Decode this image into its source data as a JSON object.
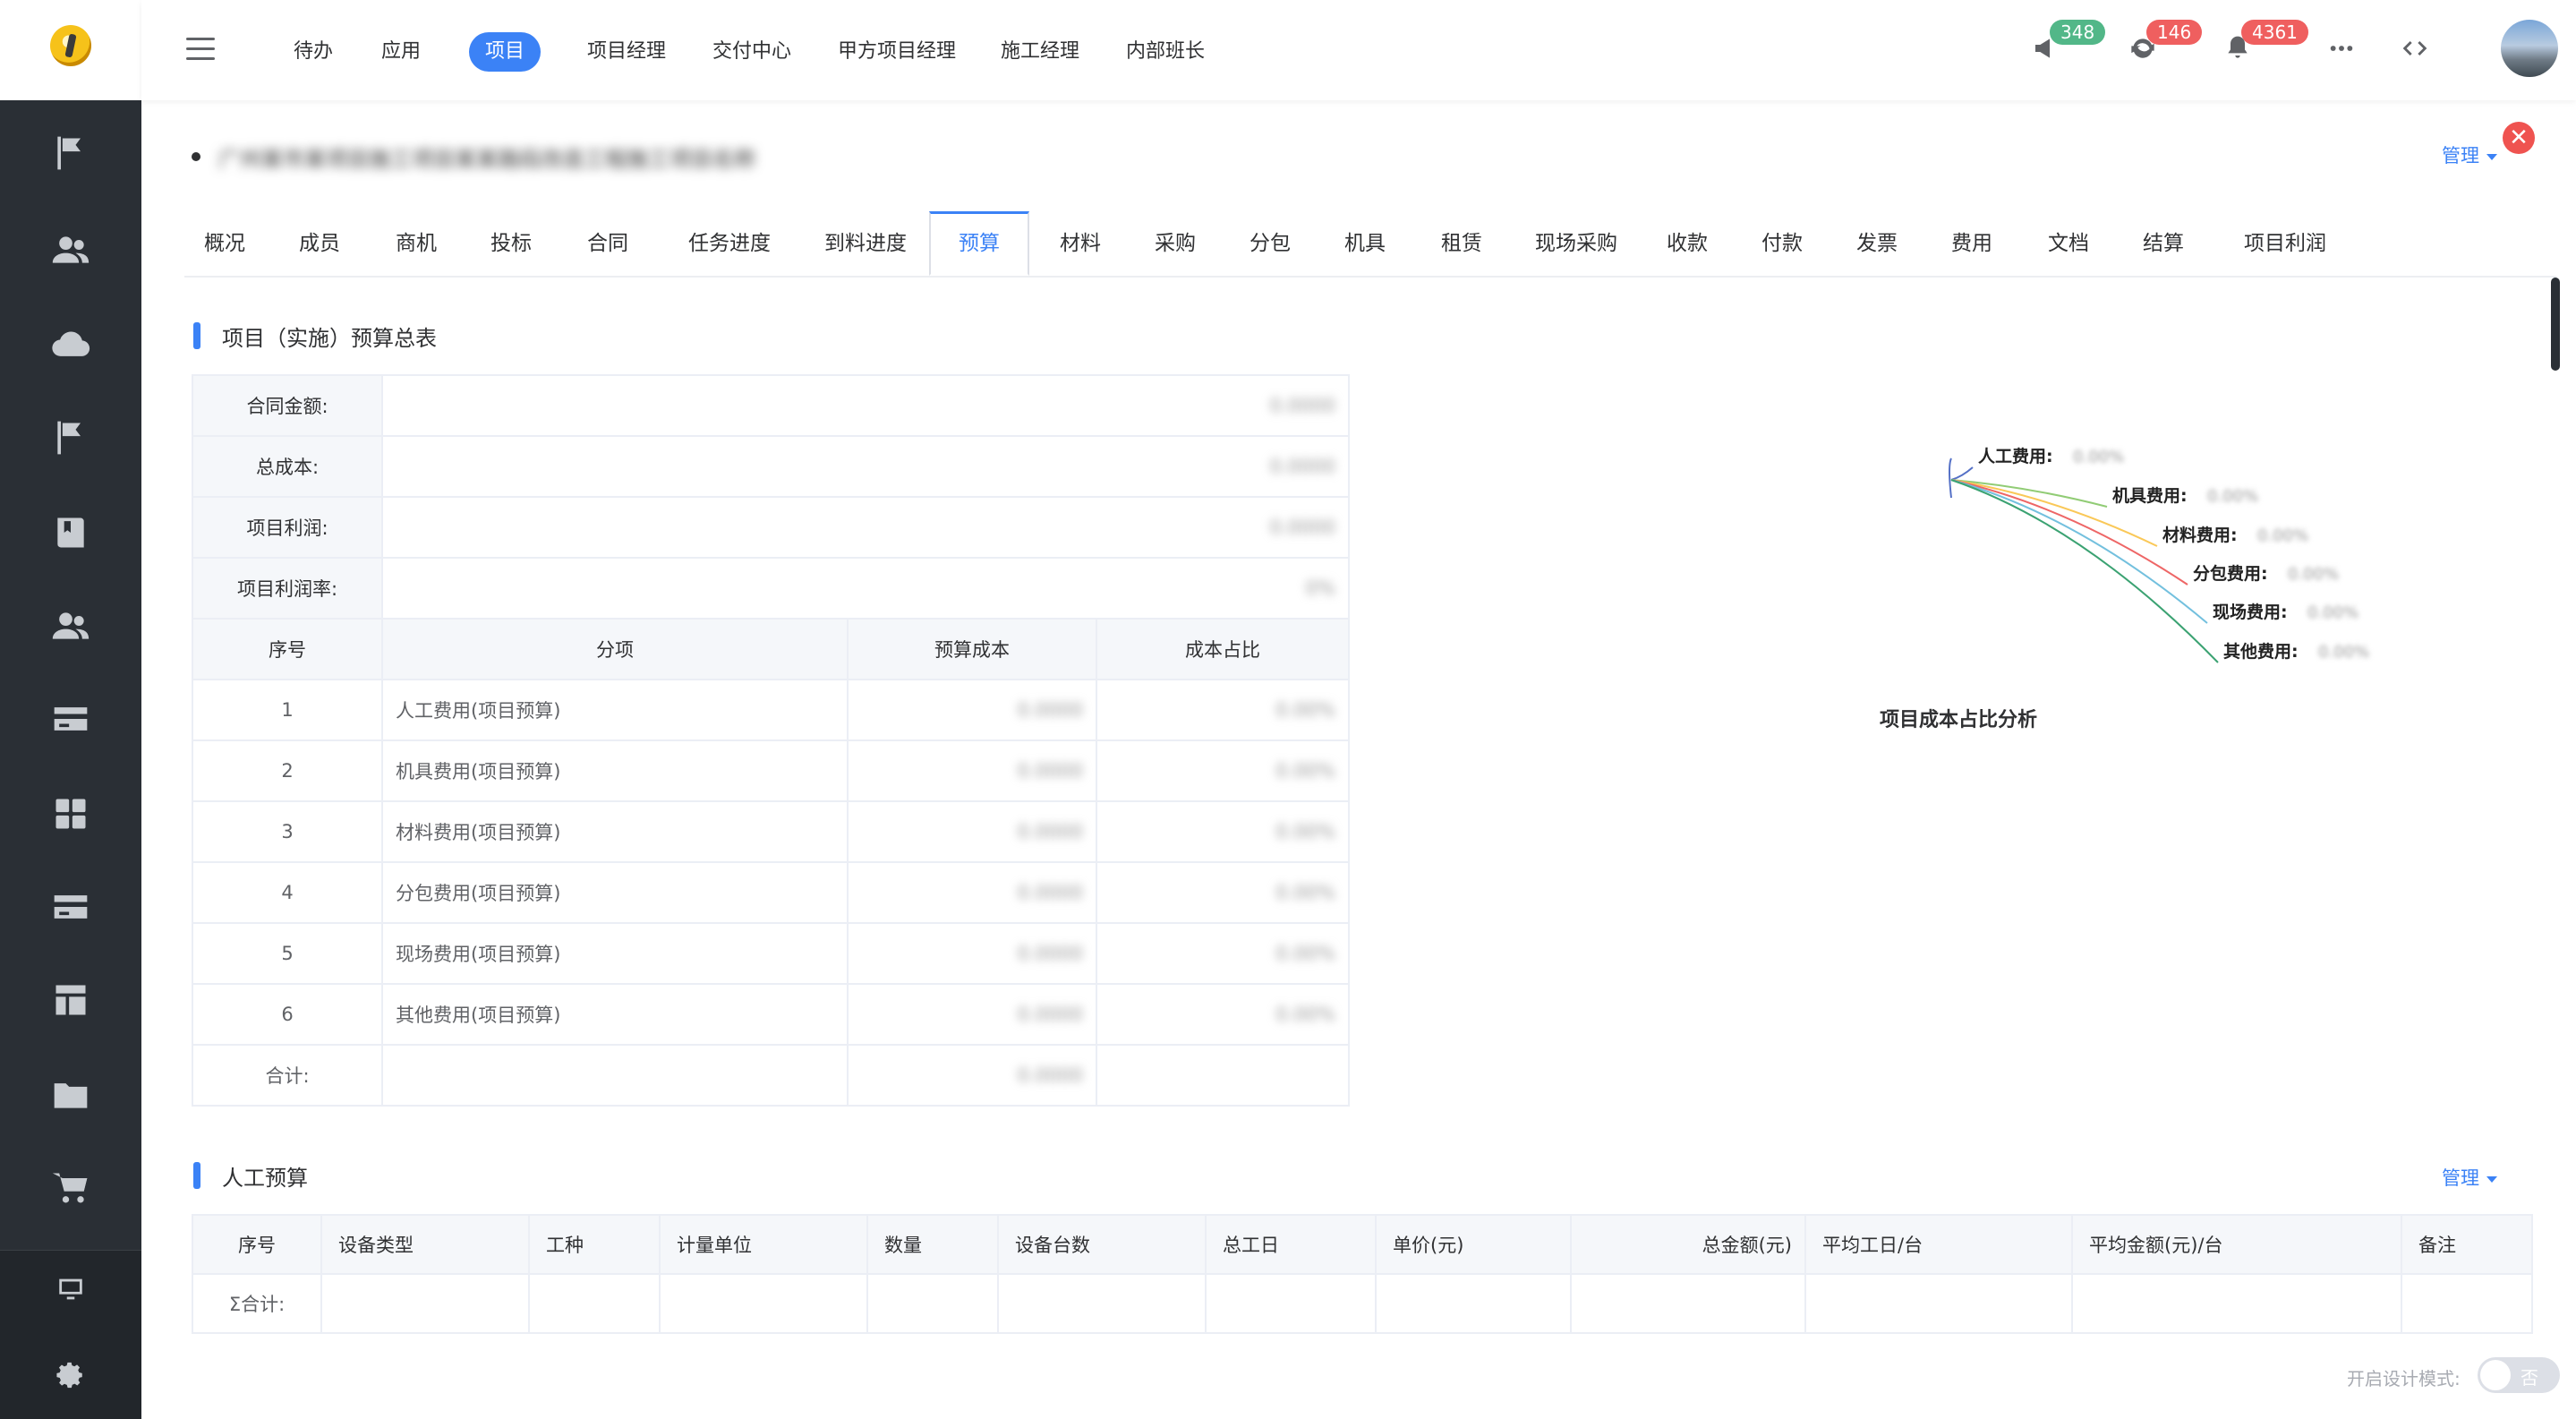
{
  "nav": {
    "items": [
      {
        "label": "待办",
        "active": false
      },
      {
        "label": "应用",
        "active": false
      },
      {
        "label": "项目",
        "active": true
      },
      {
        "label": "项目经理",
        "active": false
      },
      {
        "label": "交付中心",
        "active": false
      },
      {
        "label": "甲方项目经理",
        "active": false
      },
      {
        "label": "施工经理",
        "active": false
      },
      {
        "label": "内部班长",
        "active": false
      }
    ],
    "badges": {
      "announce": "348",
      "sync": "146",
      "bell": "4361"
    },
    "badge_colors": {
      "announce": "#52b788",
      "sync": "#ef5f5f",
      "bell": "#ef5f5f"
    }
  },
  "sidebar_icons": [
    "flag-icon",
    "users-icon",
    "cloud-icon",
    "flag-icon",
    "book-icon",
    "users-icon",
    "card-icon",
    "grid-icon",
    "card-icon",
    "layout-icon",
    "folder-icon",
    "cart-icon",
    "monitor-icon",
    "gear-icon"
  ],
  "project": {
    "title": "广州某市某项目施工项目某某路段改造工程施工项目名称",
    "manage_label": "管理",
    "close_label": "✕"
  },
  "tabs": [
    "概况",
    "成员",
    "商机",
    "投标",
    "合同",
    "任务进度",
    "到料进度",
    "预算",
    "材料",
    "采购",
    "分包",
    "机具",
    "租赁",
    "现场采购",
    "收款",
    "付款",
    "发票",
    "费用",
    "文档",
    "结算",
    "项目利润"
  ],
  "active_tab": "预算",
  "budget": {
    "section_title": "项目（实施）预算总表",
    "summary": [
      {
        "label": "合同金额:",
        "value": "0.0000"
      },
      {
        "label": "总成本:",
        "value": "0.0000"
      },
      {
        "label": "项目利润:",
        "value": "0.0000"
      },
      {
        "label": "项目利润率:",
        "value": "0%"
      }
    ],
    "columns": [
      "序号",
      "分项",
      "预算成本",
      "成本占比"
    ],
    "rows": [
      {
        "no": "1",
        "name": "人工费用(项目预算)",
        "cost": "0.0000",
        "ratio": "0.00%"
      },
      {
        "no": "2",
        "name": "机具费用(项目预算)",
        "cost": "0.0000",
        "ratio": "0.00%"
      },
      {
        "no": "3",
        "name": "材料费用(项目预算)",
        "cost": "0.0000",
        "ratio": "0.00%"
      },
      {
        "no": "4",
        "name": "分包费用(项目预算)",
        "cost": "0.0000",
        "ratio": "0.00%"
      },
      {
        "no": "5",
        "name": "现场费用(项目预算)",
        "cost": "0.0000",
        "ratio": "0.00%"
      },
      {
        "no": "6",
        "name": "其他费用(项目预算)",
        "cost": "0.0000",
        "ratio": "0.00%"
      }
    ],
    "total_label": "合计:",
    "total_value": "0.0000"
  },
  "chart_data": {
    "type": "pie",
    "title": "项目成本占比分析",
    "categories": [
      "人工费用:",
      "机具费用:",
      "材料费用:",
      "分包费用:",
      "现场费用:",
      "其他费用:"
    ],
    "values": [
      0,
      0,
      0,
      0,
      0,
      0
    ],
    "value_labels": [
      "0.00%",
      "0.00%",
      "0.00%",
      "0.00%",
      "0.00%",
      "0.00%"
    ],
    "colors": [
      "#5470c6",
      "#91cc75",
      "#fac858",
      "#ee6666",
      "#73c0de",
      "#3ba272"
    ]
  },
  "labor": {
    "section_title": "人工预算",
    "manage_label": "管理",
    "columns": [
      "序号",
      "设备类型",
      "工种",
      "计量单位",
      "数量",
      "设备台数",
      "总工日",
      "单价(元)",
      "总金额(元)",
      "平均工日/台",
      "平均金额(元)/台",
      "备注"
    ],
    "total_label": "Σ合计:"
  },
  "footer": {
    "design_mode_label": "开启设计模式:",
    "toggle_label": "否"
  }
}
